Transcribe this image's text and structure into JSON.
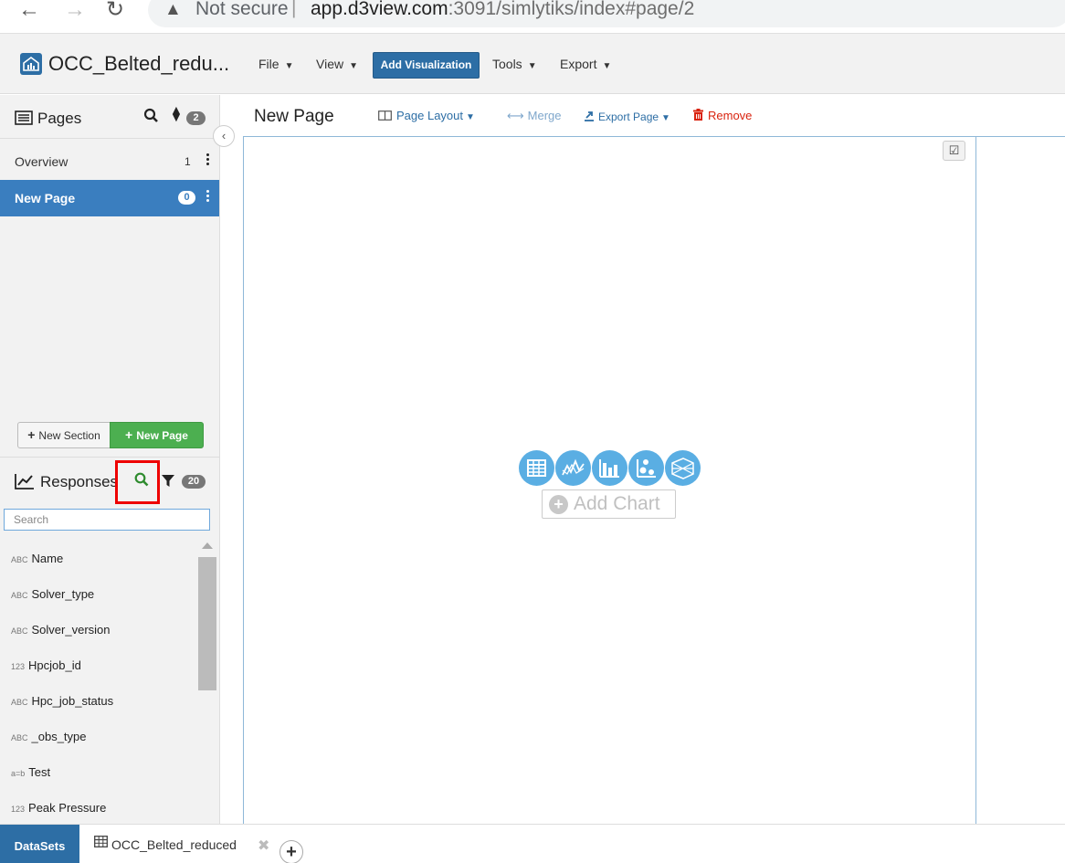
{
  "browser": {
    "warning_text": "Not secure",
    "url_host": "app.d3view.com",
    "url_path": ":3091/simlytiks/index#page/2"
  },
  "app": {
    "title": "OCC_Belted_redu...",
    "menus": {
      "file": "File",
      "view": "View",
      "add_visualization": "Add Visualization",
      "tools": "Tools",
      "export": "Export"
    }
  },
  "pages": {
    "label": "Pages",
    "count": "2",
    "items": [
      {
        "label": "Overview",
        "count": "1"
      },
      {
        "label": "New Page",
        "count": "0"
      }
    ],
    "new_section": "New Section",
    "new_page": "New Page"
  },
  "responses": {
    "label": "Responses",
    "count": "20",
    "search_placeholder": "Search",
    "items": [
      {
        "type": "ABC",
        "name": "Name"
      },
      {
        "type": "ABC",
        "name": "Solver_type"
      },
      {
        "type": "ABC",
        "name": "Solver_version"
      },
      {
        "type": "123",
        "name": "Hpcjob_id"
      },
      {
        "type": "ABC",
        "name": "Hpc_job_status"
      },
      {
        "type": "ABC",
        "name": "_obs_type"
      },
      {
        "type": "a=b",
        "name": "Test"
      },
      {
        "type": "123",
        "name": "Peak Pressure"
      }
    ]
  },
  "main": {
    "page_title": "New Page",
    "toolbar": {
      "page_layout": "Page Layout",
      "merge": "Merge",
      "export_page": "Export Page",
      "remove": "Remove"
    },
    "add_chart": "Add Chart"
  },
  "bottom": {
    "datasets": "DataSets",
    "file_tab": "OCC_Belted_reduced"
  },
  "colors": {
    "accent": "#2d6ea5",
    "selected_row": "#3a7ebf",
    "new_page_button": "#4caf50",
    "remove": "#d9230f",
    "highlight_box": "#ee0000",
    "chart_icon": "#5aaee3"
  }
}
